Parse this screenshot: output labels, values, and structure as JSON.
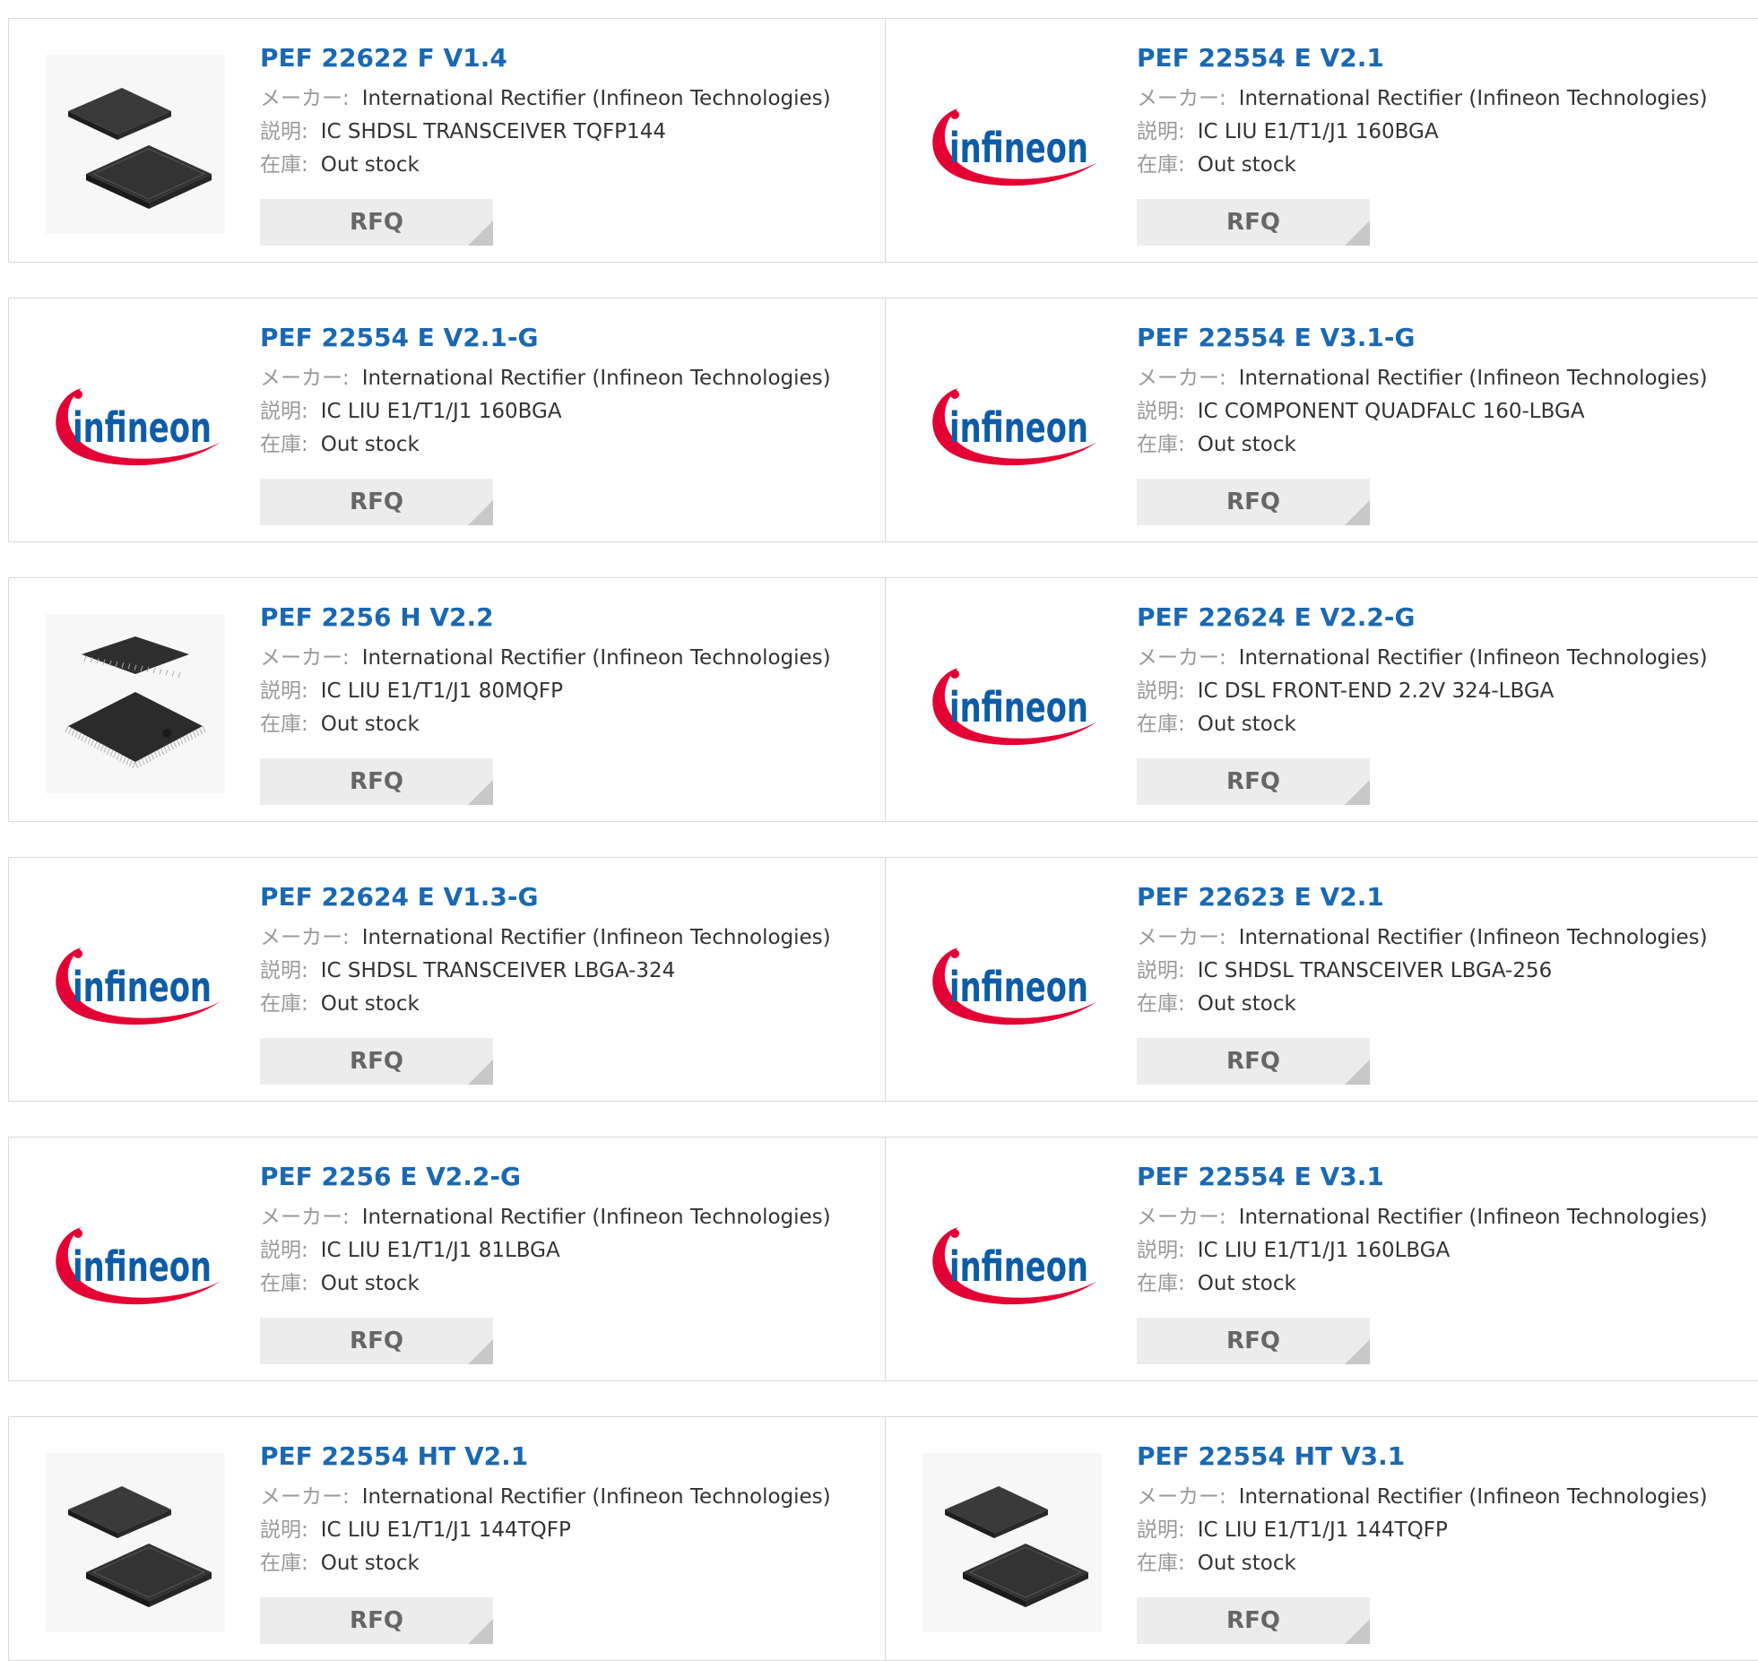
{
  "labels": {
    "maker": "メーカー:",
    "description": "説明:",
    "stock": "在庫:",
    "rfq": "RFQ"
  },
  "colors": {
    "part_link": "#1a68b2",
    "logo_arc": "#e30034",
    "logo_text": "#0d5ca8",
    "rfq_bg": "#ececec"
  },
  "rows": [
    [
      {
        "part": "PEF 22622 F V1.4",
        "maker": "International Rectifier (Infineon Technologies)",
        "description": "IC SHDSL TRANSCEIVER TQFP144",
        "stock": "Out stock",
        "image": "qfp-chip-icon"
      },
      {
        "part": "PEF 22554 E V2.1",
        "maker": "International Rectifier (Infineon Technologies)",
        "description": "IC LIU E1/T1/J1 160BGA",
        "stock": "Out stock",
        "image": "infineon-logo"
      }
    ],
    [
      {
        "part": "PEF 22554 E V2.1-G",
        "maker": "International Rectifier (Infineon Technologies)",
        "description": "IC LIU E1/T1/J1 160BGA",
        "stock": "Out stock",
        "image": "infineon-logo"
      },
      {
        "part": "PEF 22554 E V3.1-G",
        "maker": "International Rectifier (Infineon Technologies)",
        "description": "IC COMPONENT QUADFALC 160-LBGA",
        "stock": "Out stock",
        "image": "infineon-logo"
      }
    ],
    [
      {
        "part": "PEF 2256 H V2.2",
        "maker": "International Rectifier (Infineon Technologies)",
        "description": "IC LIU E1/T1/J1 80MQFP",
        "stock": "Out stock",
        "image": "mqfp-chip-icon"
      },
      {
        "part": "PEF 22624 E V2.2-G",
        "maker": "International Rectifier (Infineon Technologies)",
        "description": "IC DSL FRONT-END 2.2V 324-LBGA",
        "stock": "Out stock",
        "image": "infineon-logo"
      }
    ],
    [
      {
        "part": "PEF 22624 E V1.3-G",
        "maker": "International Rectifier (Infineon Technologies)",
        "description": "IC SHDSL TRANSCEIVER LBGA-324",
        "stock": "Out stock",
        "image": "infineon-logo"
      },
      {
        "part": "PEF 22623 E V2.1",
        "maker": "International Rectifier (Infineon Technologies)",
        "description": "IC SHDSL TRANSCEIVER LBGA-256",
        "stock": "Out stock",
        "image": "infineon-logo"
      }
    ],
    [
      {
        "part": "PEF 2256 E V2.2-G",
        "maker": "International Rectifier (Infineon Technologies)",
        "description": "IC LIU E1/T1/J1 81LBGA",
        "stock": "Out stock",
        "image": "infineon-logo"
      },
      {
        "part": "PEF 22554 E V3.1",
        "maker": "International Rectifier (Infineon Technologies)",
        "description": "IC LIU E1/T1/J1 160LBGA",
        "stock": "Out stock",
        "image": "infineon-logo"
      }
    ],
    [
      {
        "part": "PEF 22554 HT V2.1",
        "maker": "International Rectifier (Infineon Technologies)",
        "description": "IC LIU E1/T1/J1 144TQFP",
        "stock": "Out stock",
        "image": "qfp-chip-icon"
      },
      {
        "part": "PEF 22554 HT V3.1",
        "maker": "International Rectifier (Infineon Technologies)",
        "description": "IC LIU E1/T1/J1 144TQFP",
        "stock": "Out stock",
        "image": "qfp-chip-icon"
      }
    ]
  ]
}
